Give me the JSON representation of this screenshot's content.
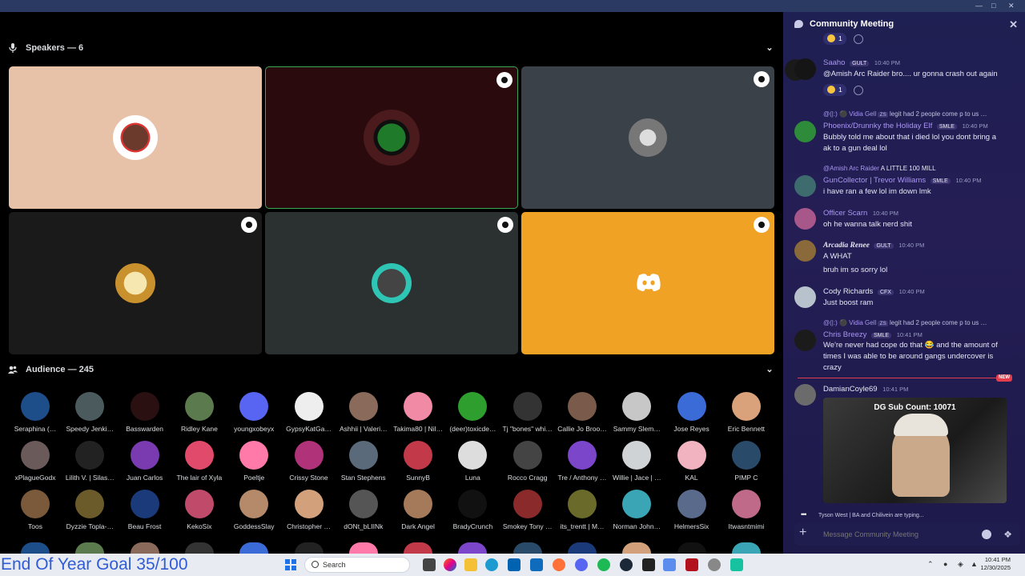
{
  "speakers": {
    "title": "Speakers — 6"
  },
  "audience": {
    "title": "Audience — 245",
    "members": [
      "Seraphina (…",
      "Speedy Jenki…",
      "Basswarden",
      "Ridley Kane",
      "youngxobeyx",
      "GypsyKatGa…",
      "Ashhii | Valeri…",
      "Takima80 | Nil…",
      "(deer)toxicde…",
      "Tj \"bones\" whi…",
      "Callie Jo Broo…",
      "Sammy Slem…",
      "Jose Reyes",
      "Eric Bennett",
      "xPlagueGodx",
      "Lilith V. | Silas…",
      "Juan Carlos",
      "The lair of Xyla",
      "Poeltje",
      "Crissy Stone",
      "Stan Stephens",
      "SunnyB",
      "Luna",
      "Rocco Cragg",
      "Tre / Anthony …",
      "Willie | Jace | …",
      "KAL",
      "PIMP C",
      "Toos",
      "Dyzzie Topla-…",
      "Beau Frost",
      "KekoSix",
      "GoddessSlay",
      "Christopher …",
      "dONt_bLIINk",
      "Dark Angel",
      "BradyCrunch",
      "Smokey Tony …",
      "its_trentt | M…",
      "Norman John…",
      "HelmersSix",
      "Itwasntmimi"
    ]
  },
  "chat": {
    "title": "Community Meeting",
    "top_reaction_count": "1",
    "messages": [
      {
        "name": "Saaho",
        "tag": "GULT",
        "time": "10:40 PM",
        "text": "@Amish Arc Raider bro.... ur gonna crash out again",
        "reaction": "1"
      },
      {
        "reply_name": "@(|:) ⚫ Vidia Gell",
        "reply_tag": "ZS",
        "reply_text": "legit had 2 people come p to us …",
        "name": "Phoenix/Drunnky the Holiday Elf",
        "tag": "SMLE",
        "time": "10:40 PM",
        "text1": "Bubbly told me about that i died lol you dont bring a",
        "text2": "ak to a gun deal lol"
      },
      {
        "reply_name": "@Amish Arc Raider",
        "reply_text": "A LITTLE  100 MILL",
        "name": "GunCollector | Trevor Williams",
        "tag": "SMLE",
        "time": "10:40 PM",
        "text": "i have ran a few lol im down lmk"
      },
      {
        "name": "Officer Scarn",
        "time": "10:40 PM",
        "text": "oh he wanna talk nerd shit"
      },
      {
        "name": "Arcadia Renee",
        "tag": "GULT",
        "time": "10:40 PM",
        "text1": "A WHAT",
        "text2": "bruh im so sorry lol"
      },
      {
        "name": "Cody Richards",
        "tag": "CFX",
        "time": "10:40 PM",
        "text": "Just boost ram"
      },
      {
        "reply_name": "@(|:) ⚫ Vidia Gell",
        "reply_tag": "ZS",
        "reply_text": "legit had 2 people come p to us …",
        "name": "Chris Breezy",
        "tag": "SMLE",
        "time": "10:41 PM",
        "text1": "We're never had cope do that 😂 and the amount of",
        "text2": "times I was able to be around gangs undercover is",
        "text3": "crazy"
      },
      {
        "new_label": "NEW",
        "name": "DamianCoyle69",
        "time": "10:41 PM",
        "embed_caption": "DG Sub Count: 10071"
      }
    ],
    "typing": "Tyson West | BA and Chilivein are typing...",
    "placeholder": "Message Community Meeting"
  },
  "overlay": "End Of Year Goal 35/100",
  "taskbar": {
    "search": "Search",
    "time": "10:41 PM",
    "date": "12/30/2025"
  },
  "colors": {
    "accent": "#5865f2",
    "discord_orange": "#f0a224",
    "tile_beige": "#e8c2a8",
    "tile_maroon": "#2a0a0c"
  }
}
